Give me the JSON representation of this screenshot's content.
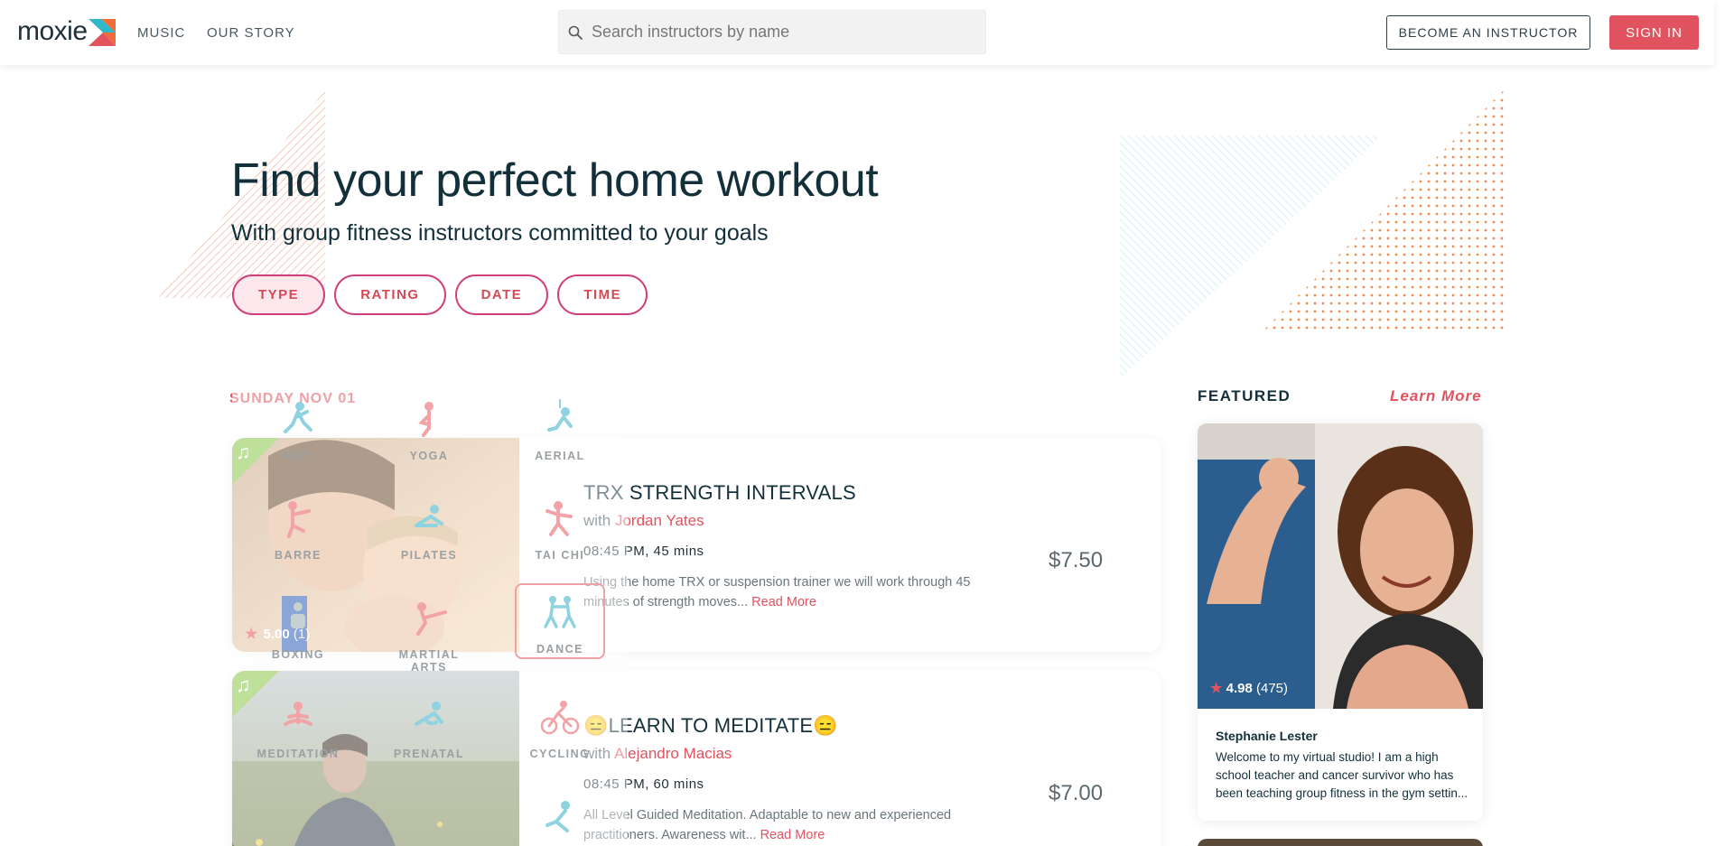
{
  "header": {
    "logo_text": "moxie",
    "nav": [
      "MUSIC",
      "OUR STORY"
    ],
    "search_placeholder": "Search instructors by name",
    "become_label": "BECOME AN INSTRUCTOR",
    "signin_label": "SIGN IN"
  },
  "hero": {
    "title": "Find your perfect home workout",
    "subtitle": "With group fitness instructors committed to your goals",
    "filters": [
      "TYPE",
      "RATING",
      "DATE",
      "TIME"
    ],
    "active_filter": "TYPE"
  },
  "type_menu": {
    "items": [
      "HIIT",
      "YOGA",
      "AERIAL",
      "BARRE",
      "PILATES",
      "TAI CHI",
      "BOXING",
      "MARTIAL ARTS",
      "DANCE",
      "MEDITATION",
      "PRENATAL",
      "CYCLING"
    ],
    "selected": "DANCE"
  },
  "schedule": {
    "date": "SUNDAY NOV 01",
    "classes": [
      {
        "title": "TRX STRENGTH INTERVALS",
        "with": "with",
        "instructor": "Jordan Yates",
        "time": "08:45 PM, 45 mins",
        "desc": "Using the home TRX or suspension trainer we will work through 45 minutes of strength moves...",
        "read_more": "Read More",
        "price": "$7.50",
        "rating": "5.00",
        "rating_count": "(1)"
      },
      {
        "title": "😑LEARN TO MEDITATE😑",
        "with": "with",
        "instructor": "Alejandro Macias",
        "time": "08:45 PM, 60 mins",
        "desc": "All Level Guided Meditation. Adaptable to new and experienced practitioners. Awareness wit...",
        "read_more": "Read More",
        "price": "$7.00",
        "rating": "",
        "rating_count": ""
      }
    ]
  },
  "featured": {
    "label": "FEATURED",
    "learn_more": "Learn More",
    "instructor": {
      "name": "Stephanie Lester",
      "bio": "Welcome to my virtual studio! I am a high school teacher and cancer survivor who has been teaching group fitness in the gym settin...",
      "rating": "4.98",
      "rating_count": "(475)"
    }
  },
  "colors": {
    "accent": "#e1535f",
    "filter_border": "#cf3f7a",
    "music_badge": "#8ac74a",
    "text_dark": "#13303a"
  }
}
